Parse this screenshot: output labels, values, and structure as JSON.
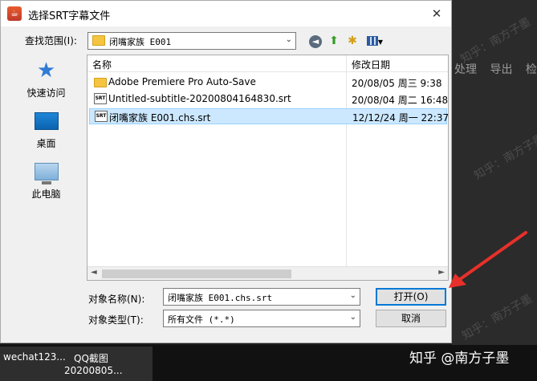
{
  "background": {
    "menu": [
      "处理",
      "导出",
      "检查"
    ],
    "taskbar": {
      "item1": "wechat123...",
      "item2_line1": "QQ截图",
      "item2_line2": "20200805..."
    },
    "watermark": "知乎 @南方子墨",
    "watermark_small": "知乎：南方子墨"
  },
  "dialog": {
    "title": "选择SRT字幕文件",
    "close_glyph": "✕",
    "look_in_label": "查找范围(I):",
    "look_in_value": "闭嘴家族 E001",
    "places": [
      {
        "label": "快速访问",
        "icon": "quick-access-star-icon"
      },
      {
        "label": "桌面",
        "icon": "desktop-icon"
      },
      {
        "label": "此电脑",
        "icon": "this-pc-icon"
      }
    ],
    "columns": {
      "name": "名称",
      "date": "修改日期"
    },
    "files": [
      {
        "name": "Adobe Premiere Pro Auto-Save",
        "date": "20/08/05 周三 9:38",
        "type": "folder",
        "selected": false
      },
      {
        "name": "Untitled-subtitle-20200804164830.srt",
        "date": "20/08/04 周二 16:48",
        "type": "srt",
        "selected": false
      },
      {
        "name": "闭嘴家族 E001.chs.srt",
        "date": "12/12/24 周一 22:37",
        "type": "srt",
        "selected": true
      }
    ],
    "srt_icon_text": "SRT",
    "filename_label": "对象名称(N):",
    "filename_value": "闭嘴家族 E001.chs.srt",
    "filetype_label": "对象类型(T):",
    "filetype_value": "所有文件 (*.*)",
    "open_button": "打开(O)",
    "cancel_button": "取消"
  },
  "colors": {
    "selection": "#cce8ff",
    "accent": "#0078d7",
    "arrow": "#e8302a"
  }
}
